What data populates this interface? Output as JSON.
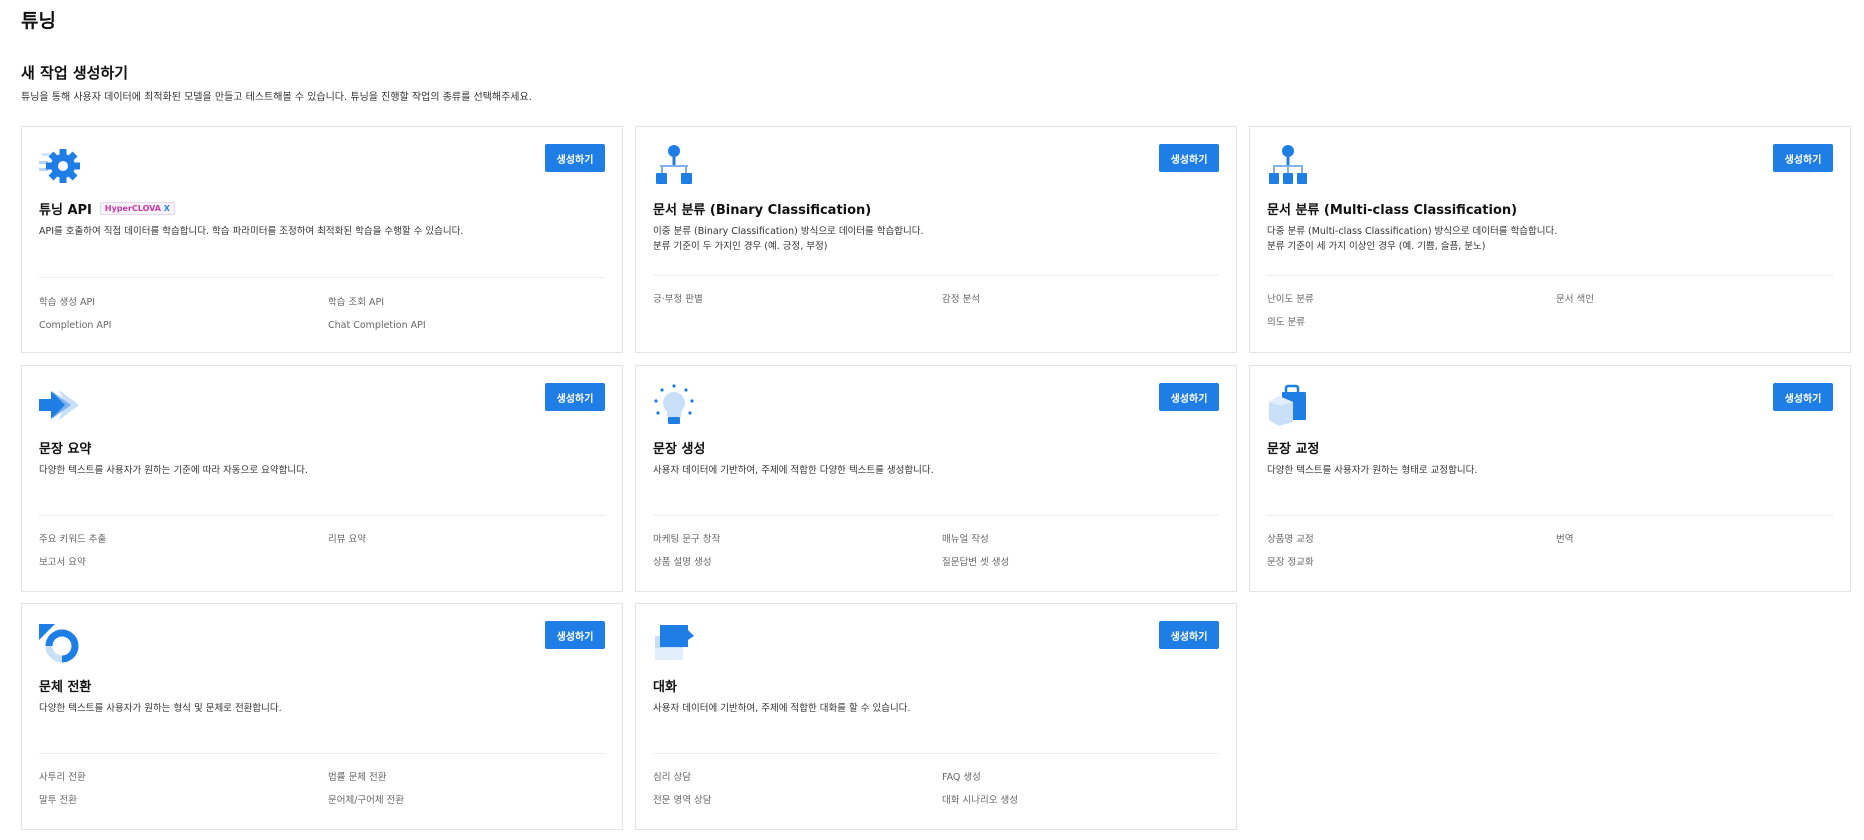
{
  "header": {
    "title": "튜닝",
    "section_title": "새 작업 생성하기",
    "section_desc": "튜닝을 통해 사용자 데이터에 최적화된 모델을 만들고 테스트해볼 수 있습니다. 튜닝을 진행할 작업의 종류를 선택해주세요."
  },
  "accent_color": "#1f7de6",
  "cards": [
    {
      "icon": "gear-icon",
      "title": "튜닝 API",
      "badge": "HyperCLOVA",
      "badge_suffix": "X",
      "button": "생성하기",
      "desc": [
        "API를 호출하여 직접 데이터를 학습합니다. 학습 파라미터를 조정하여 최적화된 학습을 수행할 수 있습니다."
      ],
      "features": [
        "학습 생성 API",
        "학습 조회 API",
        "Completion API",
        "Chat Completion API"
      ]
    },
    {
      "icon": "binary-tree-icon",
      "title": "문서 분류 (Binary Classification)",
      "button": "생성하기",
      "desc": [
        "이중 분류 (Binary Classification) 방식으로 데이터를 학습합니다.",
        "분류 기준이 두 가지인 경우 (예. 긍정, 부정)"
      ],
      "features": [
        "긍·부정 판별",
        "감정 분석"
      ]
    },
    {
      "icon": "multi-tree-icon",
      "title": "문서 분류 (Multi-class Classification)",
      "button": "생성하기",
      "desc": [
        "다중 분류 (Multi-class Classification) 방식으로 데이터를 학습합니다.",
        "분류 기준이 세 가지 이상인 경우 (예. 기쁨, 슬픔, 분노)"
      ],
      "features": [
        "난이도 분류",
        "문서 색인",
        "의도 분류"
      ]
    },
    {
      "icon": "summary-arrow-icon",
      "title": "문장 요약",
      "button": "생성하기",
      "desc": [
        "다양한 텍스트를 사용자가 원하는 기준에 따라 자동으로 요약합니다."
      ],
      "features": [
        "주요 키워드 추출",
        "리뷰 요약",
        "보고서 요약"
      ]
    },
    {
      "icon": "lightbulb-icon",
      "title": "문장 생성",
      "button": "생성하기",
      "desc": [
        "사용자 데이터에 기반하여, 주제에 적합한 다양한 텍스트를 생성합니다."
      ],
      "features": [
        "마케팅 문구 창작",
        "매뉴얼 작성",
        "상품 설명 생성",
        "질문답변 셋 생성"
      ]
    },
    {
      "icon": "shopping-bag-icon",
      "title": "문장 교정",
      "button": "생성하기",
      "desc": [
        "다양한 텍스트를 사용자가 원하는 형태로 교정합니다."
      ],
      "features": [
        "상품명 교정",
        "번역",
        "문장 정교화"
      ]
    },
    {
      "icon": "refresh-icon",
      "title": "문체 전환",
      "button": "생성하기",
      "desc": [
        "다양한 텍스트를 사용자가 원하는 형식 및 문체로 전환합니다."
      ],
      "features": [
        "사투리 전환",
        "법률 문체 전환",
        "말투 전환",
        "문어체/구어체 전환"
      ]
    },
    {
      "icon": "chat-bubble-icon",
      "title": "대화",
      "button": "생성하기",
      "desc": [
        "사용자 데이터에 기반하여, 주제에 적합한 대화를 할 수 있습니다."
      ],
      "features": [
        "심리 상담",
        "FAQ 생성",
        "전문 영역 상담",
        "대화 시나리오 생성"
      ]
    }
  ]
}
